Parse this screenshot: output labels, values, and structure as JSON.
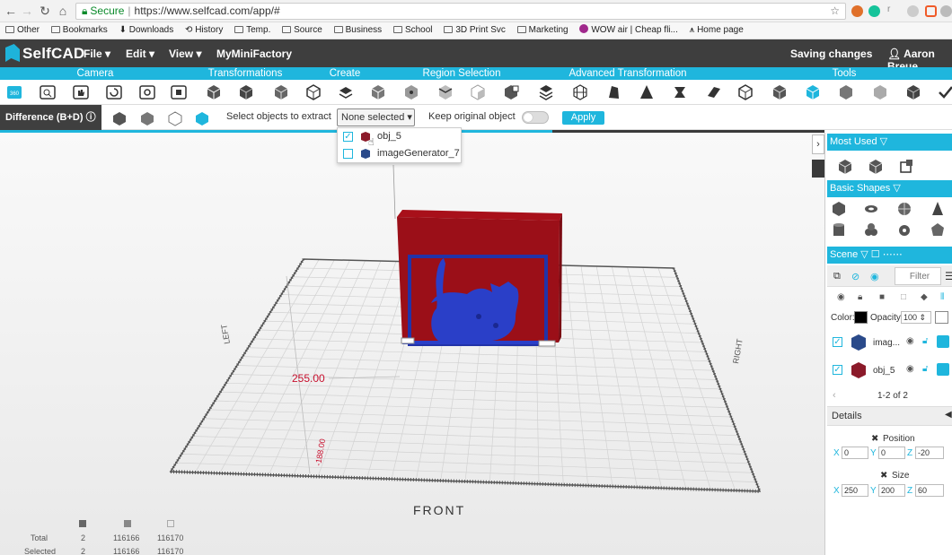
{
  "browser": {
    "url_secure_label": "Secure",
    "url": "https://www.selfcad.com/app/#",
    "bookmarks": [
      "Other",
      "Bookmarks",
      "Downloads",
      "History",
      "Temp.",
      "Source",
      "Business",
      "School",
      "3D Print Svc",
      "Marketing",
      "WOW air | Cheap fli...",
      "Home page"
    ],
    "extension_icons": [
      "chrome-ext-icon",
      "grammarly-icon",
      "r-ext-icon",
      "cloud-ext-icon",
      "cast-icon",
      "shield-ext-icon"
    ]
  },
  "app": {
    "logo": "SelfCAD",
    "menus": [
      "File",
      "Edit",
      "View",
      "MyMiniFactory"
    ],
    "status": "Saving changes",
    "user": "Aaron Breue"
  },
  "categories": [
    "Camera",
    "Transformations",
    "Create",
    "Region Selection",
    "Advanced Transformation",
    "Tools"
  ],
  "operation": {
    "name": "Difference (B+D)",
    "select_label": "Select objects to extract",
    "dropdown_value": "None selected",
    "keep_label": "Keep original object",
    "keep_enabled": false,
    "apply_label": "Apply",
    "progress": 0.67
  },
  "dropdown_items": [
    {
      "label": "obj_5",
      "checked": true,
      "color": "#8b1a2a"
    },
    {
      "label": "imageGenerator_7",
      "checked": false,
      "color": "#2a4a8a"
    }
  ],
  "viewport": {
    "dimension_label": "255.00",
    "dim_y_label": "-188.00",
    "left_label": "LEFT",
    "right_label": "RIGHT",
    "front_label": "FRONT"
  },
  "stats": {
    "rows": [
      {
        "label": "Total",
        "a": "2",
        "b": "116166",
        "c": "116170"
      },
      {
        "label": "Selected",
        "a": "2",
        "b": "116166",
        "c": "116170"
      }
    ]
  },
  "sidebar": {
    "most_used": "Most Used",
    "basic_shapes": "Basic Shapes",
    "scene": "Scene",
    "filter_placeholder": "Filter",
    "color_label": "Color:",
    "opacity_label": "Opacity:",
    "opacity_value": "100",
    "objects": [
      {
        "name": "imag...",
        "color": "#2a4a8a"
      },
      {
        "name": "obj_5",
        "color": "#8b1a2a"
      }
    ],
    "pager": "1-2 of 2",
    "details": "Details",
    "position_label": "Position",
    "size_label": "Size",
    "position": {
      "x": "0",
      "y": "0",
      "z": "-20"
    },
    "size": {
      "x": "250",
      "y": "200",
      "z": "60"
    }
  }
}
